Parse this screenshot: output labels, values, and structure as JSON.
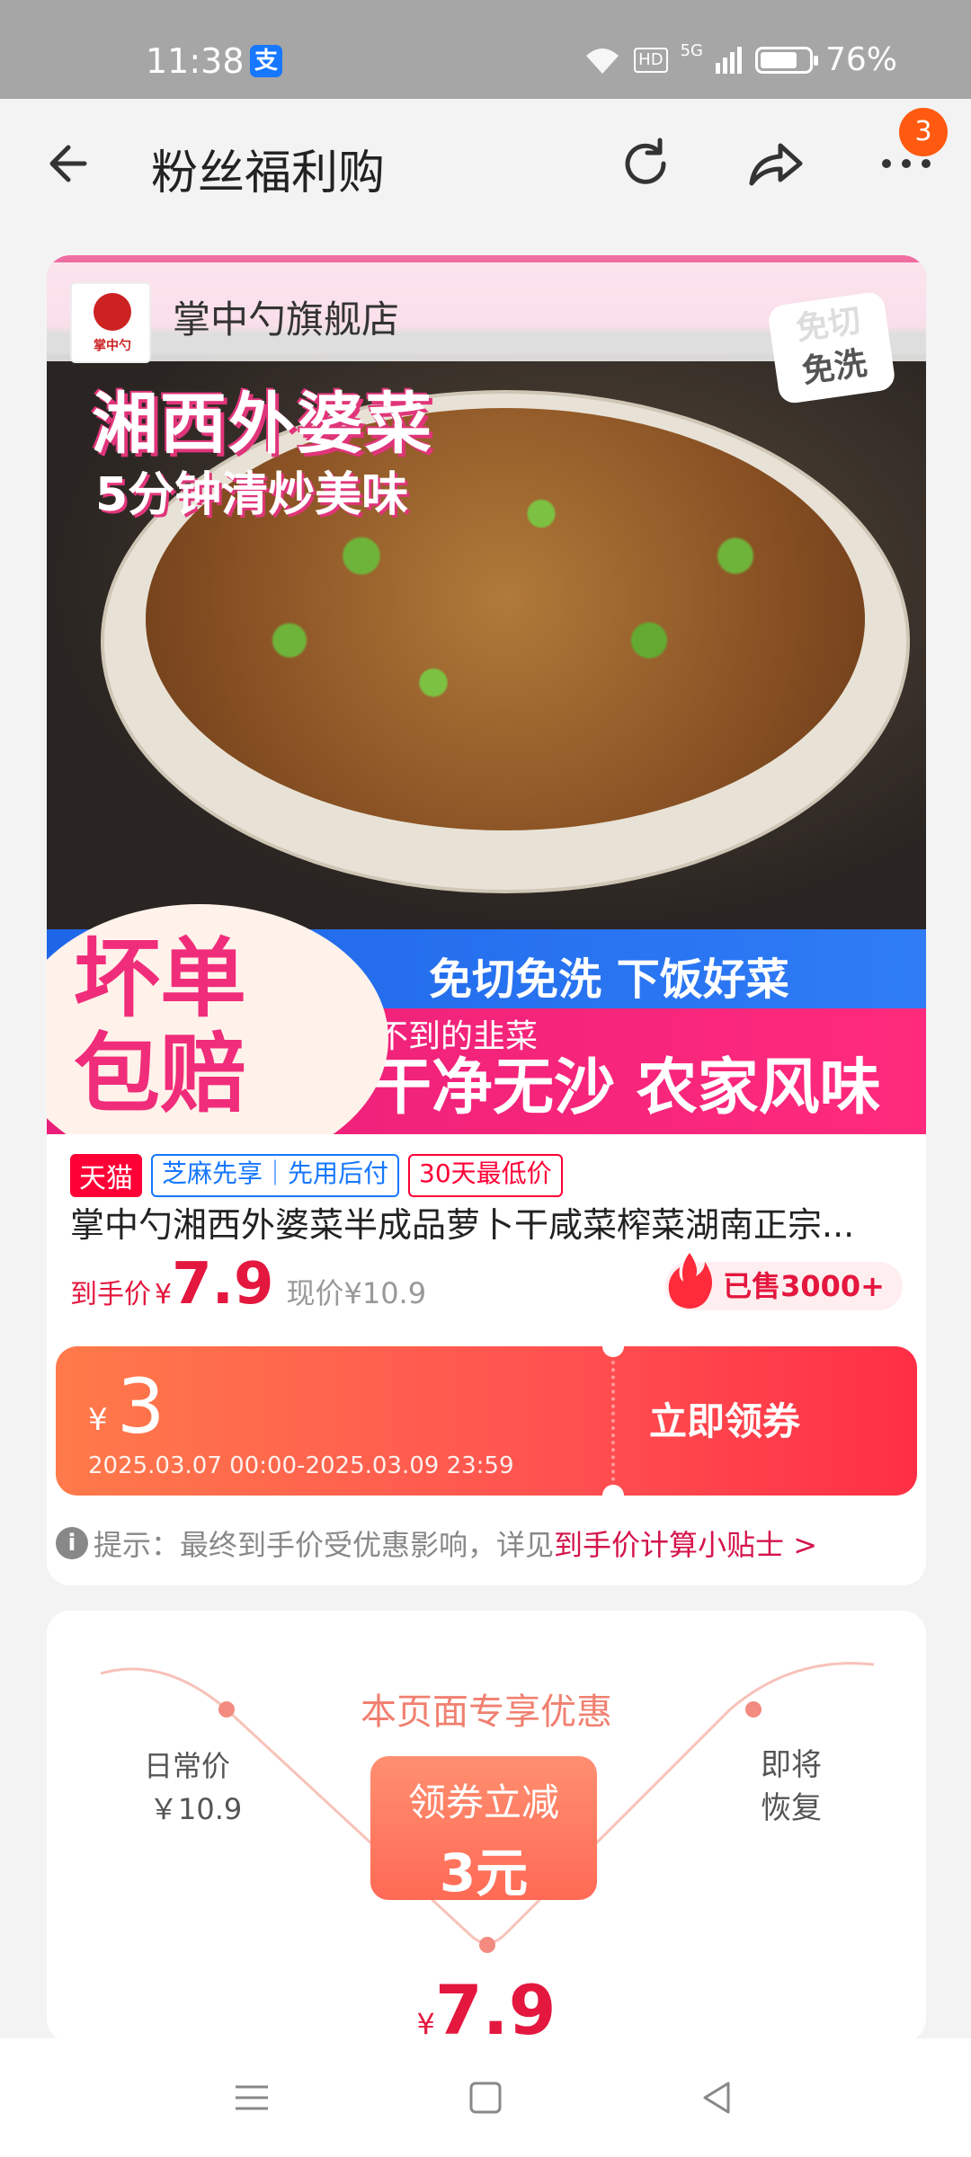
{
  "status_bar": {
    "time": "11:38",
    "alipay_icon": "支",
    "hd": "HD",
    "network": "5G",
    "battery": "76%"
  },
  "nav": {
    "title": "粉丝福利购",
    "badge_count": "3"
  },
  "store": {
    "name": "掌中勺旗舰店",
    "logo_text": "掌中勺"
  },
  "hero": {
    "title": "湘西外婆菜",
    "subtitle": "5分钟清炒美味",
    "corner_tag_line1": "免切",
    "corner_tag_line2": "免洗",
    "band_blue": "免切免洗 下饭好菜",
    "band_pink": "干净无沙 农家风味",
    "overlay": "割不到的韭菜",
    "guarantee_line1": "坏单",
    "guarantee_line2": "包赔"
  },
  "labels": {
    "tmall": "天猫",
    "sesame": "芝麻先享｜先用后付",
    "lowest": "30天最低价"
  },
  "product": {
    "title": "掌中勺湘西外婆菜半成品萝卜干咸菜榨菜湖南正宗...",
    "price_label": "到手价",
    "price_yen": "¥",
    "price_value": "7.9",
    "current_price": "现价¥10.9",
    "sold": "已售3000+"
  },
  "coupon": {
    "yen": "¥",
    "amount": "3",
    "validity": "2025.03.07 00:00-2025.03.09 23:59",
    "button": "立即领券"
  },
  "tip": {
    "prefix": "提示：最终到手价受优惠影响，详见",
    "link": "到手价计算小贴士 >"
  },
  "exclusive": {
    "title": "本页面专享优惠",
    "daily_label": "日常价",
    "daily_price": "￥10.9",
    "discount_line1": "领券立减",
    "discount_line2": "3元",
    "restore": "即将恢复",
    "final_yen": "¥",
    "final_value": "7.9"
  },
  "colors": {
    "accent": "#e4173e",
    "coupon": "#ff5050",
    "tmall": "#ff0036",
    "link": "#d4134a"
  }
}
